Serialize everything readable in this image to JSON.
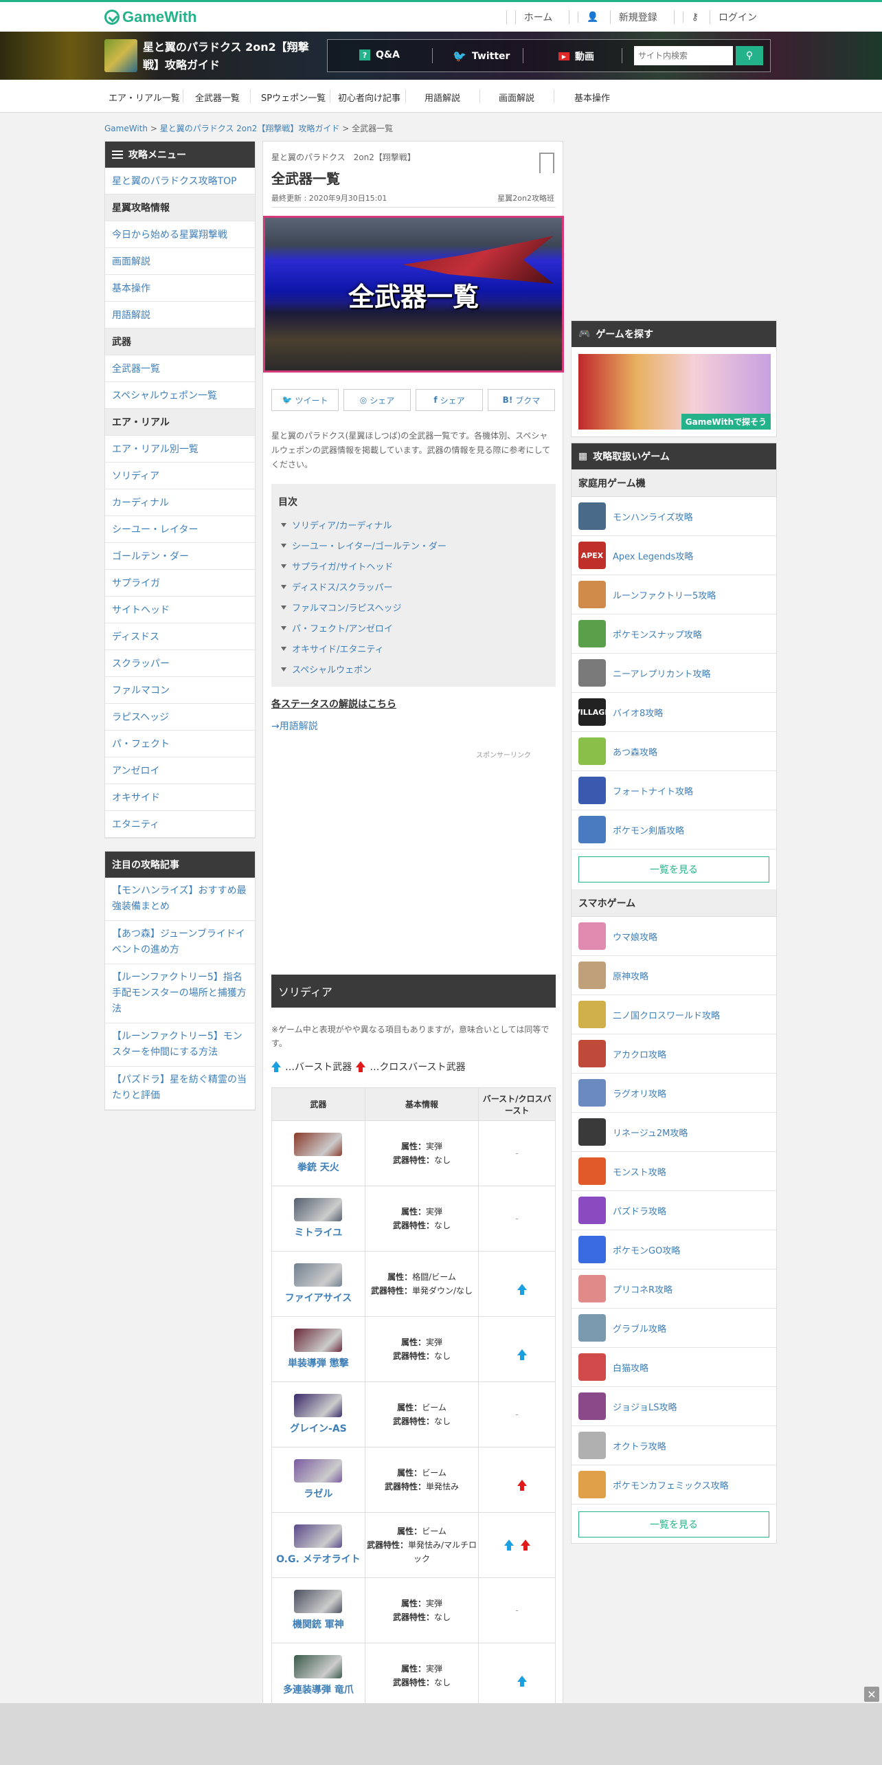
{
  "topbar": {
    "logo": "GameWith",
    "links": [
      "ホーム",
      "新規登録",
      "ログイン"
    ]
  },
  "banner": {
    "game_title": "星と翼のパラドクス 2on2【翔撃戦】攻略ガイド",
    "nav": [
      "Q&A",
      "Twitter",
      "動画"
    ],
    "search_placeholder": "サイト内検索"
  },
  "catnav": [
    "エア・リアル一覧",
    "全武器一覧",
    "SPウェポン一覧",
    "初心者向け記事",
    "用語解説",
    "画面解説",
    "基本操作"
  ],
  "breadcrumb": [
    "GameWith",
    "星と翼のパラドクス 2on2【翔撃戦】攻略ガイド",
    "全武器一覧"
  ],
  "sidebar": {
    "header": "攻略メニュー",
    "top_link": "星と翼のパラドクス攻略TOP",
    "sections": [
      {
        "title": "星翼攻略情報",
        "items": [
          "今日から始める星翼翔撃戦",
          "画面解説",
          "基本操作",
          "用語解説"
        ]
      },
      {
        "title": "武器",
        "items": [
          "全武器一覧",
          "スペシャルウェポン一覧"
        ]
      },
      {
        "title": "エア・リアル",
        "items": [
          "エア・リアル別一覧",
          "ソリディア",
          "カーディナル",
          "シーユー・レイター",
          "ゴールテン・ダー",
          "サプライガ",
          "サイトヘッド",
          "ディスドス",
          "スクラッパー",
          "ファルマコン",
          "ラピスヘッジ",
          "パ・フェクト",
          "アンゼロイ",
          "オキサイド",
          "エタニティ"
        ]
      }
    ]
  },
  "featured": {
    "header": "注目の攻略記事",
    "items": [
      "【モンハンライズ】おすすめ最強装備まとめ",
      "【あつ森】ジューンブライドイベントの進め方",
      "【ルーンファクトリー5】指名手配モンスターの場所と捕獲方法",
      "【ルーンファクトリー5】モンスターを仲間にする方法",
      "【パズドラ】星を紡ぐ精霊の当たりと評価"
    ]
  },
  "article": {
    "subtitle": "星と翼のパラドクス　2on2【翔撃戦】",
    "title": "全武器一覧",
    "updated": "最終更新 : 2020年9月30日15:01",
    "author": "星翼2on2攻略班",
    "hero_text": "全武器一覧",
    "share": [
      "ツイート",
      "シェア",
      "シェア",
      "ブクマ"
    ],
    "intro": "星と翼のパラドクス(星翼ほしつば)の全武器一覧です。各機体別、スペシャルウェポンの武器情報を掲載しています。武器の情報を見る際に参考にしてください。",
    "toc_title": "目次",
    "toc": [
      "ソリディア/カーディナル",
      "シーユー・レイター/ゴールテン・ダー",
      "サプライガ/サイトヘッド",
      "ディスドス/スクラッパー",
      "ファルマコン/ラピスヘッジ",
      "パ・フェクト/アンゼロイ",
      "オキサイド/エタニティ",
      "スペシャルウェポン"
    ],
    "status_link": "各ステータスの解説はこちら",
    "term_link": "→用語解説",
    "sponsor": "スポンサーリンク",
    "section_title": "ソリディア",
    "note": "※ゲーム中と表現がやや異なる項目もありますが，意味合いとしては同等です。",
    "legend_burst": "…バースト武器",
    "legend_cross": "…クロスバースト武器",
    "table_headers": [
      "武器",
      "基本情報",
      "バースト/クロスバースト"
    ],
    "attr_label": "属性：",
    "trait_label": "武器特性：",
    "weapons": [
      {
        "name": "拳銃 天火",
        "attr": "実弾",
        "trait": "なし",
        "burst": "-",
        "color": "#8a3a2a"
      },
      {
        "name": "ミトライユ",
        "attr": "実弾",
        "trait": "なし",
        "burst": "-",
        "color": "#556070"
      },
      {
        "name": "ファイアサイス",
        "attr": "格闘/ビーム",
        "trait": "単発ダウン/なし",
        "burst": "blue",
        "color": "#708090"
      },
      {
        "name": "単装導弾 懲撃",
        "attr": "実弾",
        "trait": "なし",
        "burst": "blue",
        "color": "#6a2a3a"
      },
      {
        "name": "グレイン-AS",
        "attr": "ビーム",
        "trait": "なし",
        "burst": "-",
        "color": "#3a2a6a"
      },
      {
        "name": "ラゼル",
        "attr": "ビーム",
        "trait": "単発怯み",
        "burst": "red",
        "color": "#7a5aa0"
      },
      {
        "name": "O.G. メテオライト",
        "attr": "ビーム",
        "trait": "単発怯み/マルチロック",
        "burst": "both",
        "color": "#5a4a8a"
      },
      {
        "name": "機関銃 軍神",
        "attr": "実弾",
        "trait": "なし",
        "burst": "-",
        "color": "#4a5060"
      },
      {
        "name": "多連装導弾 竜爪",
        "attr": "実弾",
        "trait": "なし",
        "burst": "blue",
        "color": "#3a5a4a"
      }
    ]
  },
  "right": {
    "find_header": "ゲームを探す",
    "ad_label": "GameWithで探そう",
    "list_header": "攻略取扱いゲーム",
    "home_cat": "家庭用ゲーム機",
    "home_games": [
      {
        "name": "モンハンライズ攻略",
        "color": "#4a6a8a"
      },
      {
        "name": "Apex Legends攻略",
        "color": "#c0302a",
        "tag": "APEX"
      },
      {
        "name": "ルーンファクトリー5攻略",
        "color": "#d08a4a"
      },
      {
        "name": "ポケモンスナップ攻略",
        "color": "#5aa04a"
      },
      {
        "name": "ニーアレプリカント攻略",
        "color": "#7a7a7a"
      },
      {
        "name": "バイオ8攻略",
        "color": "#222222",
        "tag": "VILLAGE"
      },
      {
        "name": "あつ森攻略",
        "color": "#8ac04a"
      },
      {
        "name": "フォートナイト攻略",
        "color": "#3a5ab0"
      },
      {
        "name": "ポケモン剣盾攻略",
        "color": "#4a7ac0"
      }
    ],
    "more": "一覧を見る",
    "mobile_cat": "スマホゲーム",
    "mobile_games": [
      {
        "name": "ウマ娘攻略",
        "color": "#e08ab0"
      },
      {
        "name": "原神攻略",
        "color": "#c0a07a"
      },
      {
        "name": "二ノ国クロスワールド攻略",
        "color": "#d0b04a"
      },
      {
        "name": "アカクロ攻略",
        "color": "#c04a3a"
      },
      {
        "name": "ラグオリ攻略",
        "color": "#6a8ac0"
      },
      {
        "name": "リネージュ2M攻略",
        "color": "#3a3a3a"
      },
      {
        "name": "モンスト攻略",
        "color": "#e05a2a"
      },
      {
        "name": "パズドラ攻略",
        "color": "#8a4ac0"
      },
      {
        "name": "ポケモンGO攻略",
        "color": "#3a6ae0"
      },
      {
        "name": "プリコネR攻略",
        "color": "#e08a8a"
      },
      {
        "name": "グラブル攻略",
        "color": "#7a9ab0"
      },
      {
        "name": "白猫攻略",
        "color": "#d04a4a"
      },
      {
        "name": "ジョジョLS攻略",
        "color": "#8a4a8a"
      },
      {
        "name": "オクトラ攻略",
        "color": "#b0b0b0"
      },
      {
        "name": "ポケモンカフェミックス攻略",
        "color": "#e0a04a"
      }
    ],
    "more2": "一覧を見る"
  }
}
